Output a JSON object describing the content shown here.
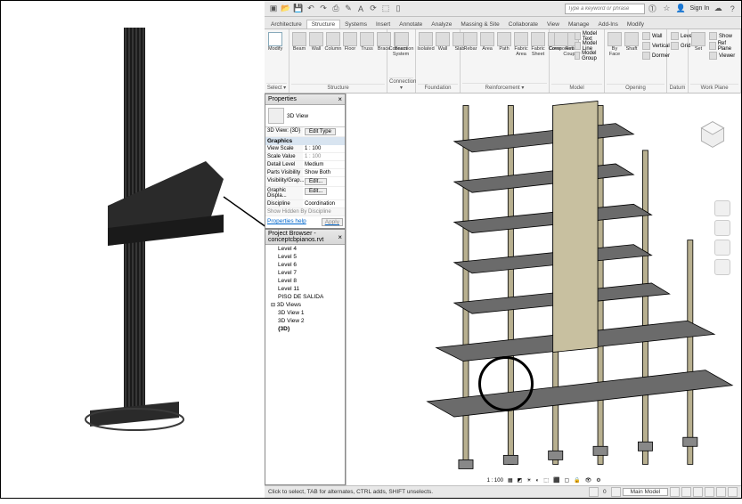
{
  "qat": {
    "search_placeholder": "Type a keyword or phrase",
    "signin": "Sign In"
  },
  "menu_tabs": [
    "Architecture",
    "Structure",
    "Systems",
    "Insert",
    "Annotate",
    "Analyze",
    "Massing & Site",
    "Collaborate",
    "View",
    "Manage",
    "Add-Ins",
    "Modify"
  ],
  "active_tab": "Structure",
  "ribbon": {
    "select_group": "Select ▾",
    "modify": "Modify",
    "beam": "Beam",
    "wall": "Wall",
    "column": "Column",
    "floor": "Floor",
    "truss": "Truss",
    "brace": "Brace",
    "beam_system": "Beam\nSystem",
    "structure_group": "Structure",
    "connection": "Connection",
    "connection_group": "Connection ▾",
    "isolated": "Isolated",
    "wall2": "Wall",
    "slab": "Slab",
    "foundation_group": "Foundation",
    "rebar": "Rebar",
    "area": "Area",
    "path": "Path",
    "fabric_area": "Fabric\nArea",
    "fabric_sheet": "Fabric\nSheet",
    "cover": "Cover",
    "rebar_coupler": "Rebar\nCoupler",
    "reinforcement_group": "Reinforcement ▾",
    "component": "Component",
    "model_text": "Model Text",
    "model_line": "Model Line",
    "model_group": "Model Group",
    "model_group_label": "Model",
    "by_face": "By\nFace",
    "shaft": "Shaft",
    "wall_opening": "Wall",
    "vertical": "Vertical",
    "dormer": "Dormer",
    "opening_group": "Opening",
    "level": "Level",
    "grid": "Grid",
    "datum_group": "Datum",
    "set": "Set",
    "show": "Show",
    "ref_plane": "Ref\nPlane",
    "viewer": "Viewer",
    "workplane_group": "Work Plane"
  },
  "properties": {
    "title": "Properties",
    "type_name": "3D View",
    "selector": "3D View: {3D}",
    "edit_type": "Edit Type",
    "graphics_section": "Graphics",
    "view_scale_label": "View Scale",
    "view_scale_value": "1 : 100",
    "scale_value_label": "Scale Value",
    "scale_value_value": "1 : 100",
    "detail_level_label": "Detail Level",
    "detail_level_value": "Medium",
    "parts_vis_label": "Parts Visibility",
    "parts_vis_value": "Show Both",
    "vis_graphics_label": "Visibility/Grap...",
    "vis_graphics_btn": "Edit...",
    "graphic_display_label": "Graphic Displa...",
    "graphic_display_btn": "Edit...",
    "discipline_label": "Discipline",
    "discipline_value": "Coordination",
    "show_hidden_label": "Show Hidden By Discipline",
    "help_link": "Properties help",
    "apply_btn": "Apply"
  },
  "browser": {
    "title": "Project Browser - conceptcbpianos.rvt",
    "items": [
      "Level 4",
      "Level 5",
      "Level 6",
      "Level 7",
      "Level 8",
      "Level 11",
      "PISO DE SALIDA"
    ],
    "group_3d": "3D Views",
    "views_3d": [
      "3D View 1",
      "3D View 2",
      "{3D}"
    ],
    "active_view": "{3D}"
  },
  "view_controls": {
    "scale": "1 : 100"
  },
  "status": {
    "hint": "Click to select, TAB for alternates, CTRL adds, SHIFT unselects.",
    "count": "0",
    "workset": "Main Model"
  }
}
